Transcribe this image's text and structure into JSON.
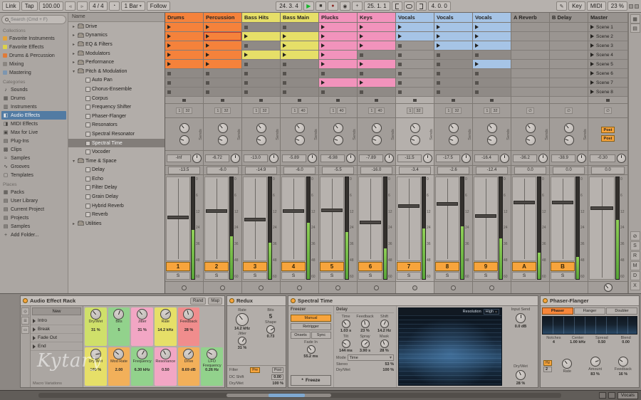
{
  "watermark": "Kytary",
  "icons": {
    "play": "▶",
    "stop": "■",
    "record": "●",
    "session_record": "◉",
    "plus": "+",
    "draw": "✎",
    "metronome": "◔",
    "nudge_down": "◃",
    "nudge_up": "▹",
    "dropdown": "▾",
    "folder_closed": "▸",
    "folder_open": "▾",
    "freeze": "*"
  },
  "transport": {
    "link": "Link",
    "tap": "Tap",
    "tempo": "100.00",
    "time_sig": "4 / 4",
    "quantize": "1 Bar",
    "follow": "Follow",
    "position": "24. 3. 4",
    "loop_start": "25. 1. 1",
    "loop_length": "4. 0. 0",
    "key": "Key",
    "midi_label": "MIDI",
    "cpu": "23 %"
  },
  "browser": {
    "search_placeholder": "Search (Cmd + F)",
    "collections_label": "Collections",
    "collections": [
      {
        "label": "Favorite Instruments",
        "color": "#e2a33c"
      },
      {
        "label": "Favorite Effects",
        "color": "#ddd24b"
      },
      {
        "label": "Drums & Percussion",
        "color": "#e07b39"
      },
      {
        "label": "Mixing",
        "color": "#8a8580"
      },
      {
        "label": "Mastering",
        "color": "#7d96b0"
      }
    ],
    "categories_label": "Categories",
    "categories": [
      {
        "label": "Sounds",
        "icon": "♪"
      },
      {
        "label": "Drums",
        "icon": "▦"
      },
      {
        "label": "Instruments",
        "icon": "▥"
      },
      {
        "label": "Audio Effects",
        "icon": "◧",
        "selected": true
      },
      {
        "label": "MIDI Effects",
        "icon": "◨"
      },
      {
        "label": "Max for Live",
        "icon": "▣"
      },
      {
        "label": "Plug-Ins",
        "icon": "▤"
      },
      {
        "label": "Clips",
        "icon": "▩"
      },
      {
        "label": "Samples",
        "icon": "≈"
      },
      {
        "label": "Grooves",
        "icon": "∿"
      },
      {
        "label": "Templates",
        "icon": "▢"
      }
    ],
    "places_label": "Places",
    "places": [
      {
        "label": "Packs",
        "icon": "▦"
      },
      {
        "label": "User Library",
        "icon": "▤"
      },
      {
        "label": "Current Project",
        "icon": "▤"
      },
      {
        "label": "Projects",
        "icon": "▤"
      },
      {
        "label": "Samples",
        "icon": "▤"
      },
      {
        "label": "Add Folder...",
        "icon": "+"
      }
    ],
    "tree_header": "Name",
    "tree": [
      {
        "label": "Drive",
        "type": "folder",
        "depth": 0
      },
      {
        "label": "Dynamics",
        "type": "folder",
        "depth": 0
      },
      {
        "label": "EQ & Filters",
        "type": "folder",
        "depth": 0
      },
      {
        "label": "Modulators",
        "type": "folder",
        "depth": 0
      },
      {
        "label": "Performance",
        "type": "folder",
        "depth": 0
      },
      {
        "label": "Pitch & Modulation",
        "type": "folder-open",
        "depth": 0
      },
      {
        "label": "Auto Pan",
        "type": "device",
        "depth": 1
      },
      {
        "label": "Chorus-Ensemble",
        "type": "device",
        "depth": 1
      },
      {
        "label": "Corpus",
        "type": "device",
        "depth": 1
      },
      {
        "label": "Frequency Shifter",
        "type": "device",
        "depth": 1
      },
      {
        "label": "Phaser-Flanger",
        "type": "device",
        "depth": 1
      },
      {
        "label": "Resonators",
        "type": "device",
        "depth": 1
      },
      {
        "label": "Spectral Resonator",
        "type": "device",
        "depth": 1
      },
      {
        "label": "Spectral Time",
        "type": "device",
        "depth": 1,
        "selected": true
      },
      {
        "label": "Vocoder",
        "type": "device",
        "depth": 1
      },
      {
        "label": "Time & Space",
        "type": "folder-open",
        "depth": 0
      },
      {
        "label": "Delay",
        "type": "device",
        "depth": 1
      },
      {
        "label": "Echo",
        "type": "device",
        "depth": 1
      },
      {
        "label": "Filter Delay",
        "type": "device",
        "depth": 1
      },
      {
        "label": "Grain Delay",
        "type": "device",
        "depth": 1
      },
      {
        "label": "Hybrid Reverb",
        "type": "device",
        "depth": 1
      },
      {
        "label": "Reverb",
        "type": "device",
        "depth": 1
      },
      {
        "label": "Utilities",
        "type": "folder",
        "depth": 0
      }
    ]
  },
  "session": {
    "sends_label": "Sends",
    "solo_label": "S",
    "meter_scale": [
      "0",
      "6",
      "12",
      "24",
      "36",
      "48",
      "60"
    ],
    "tracks": [
      {
        "name": "Drums",
        "color": "#f5823b",
        "clips": [
          1,
          1,
          1,
          1,
          1,
          0,
          0,
          0
        ],
        "io": [
          "1",
          "32"
        ],
        "peak": "-Inf",
        "vol": "-13.5",
        "btn": "1",
        "fader": 0.52,
        "meter": 0.48
      },
      {
        "name": "Percussion",
        "color": "#f5823b",
        "clips": [
          1,
          2,
          1,
          1,
          1,
          0,
          0,
          0
        ],
        "io": [
          "1",
          "32"
        ],
        "peak": "-6.72",
        "vol": "-6.0",
        "btn": "2",
        "fader": 0.6,
        "meter": 0.42
      },
      {
        "name": "Bass Hits",
        "color": "#e6df68",
        "clips": [
          0,
          1,
          0,
          1,
          0,
          0,
          0,
          0
        ],
        "io": [
          "1",
          "32"
        ],
        "peak": "-13.0",
        "vol": "-14.9",
        "btn": "3",
        "fader": 0.5,
        "meter": 0.36
      },
      {
        "name": "Bass Main",
        "color": "#e6df68",
        "clips": [
          0,
          1,
          1,
          1,
          0,
          0,
          0,
          0
        ],
        "io": [
          "1",
          "40"
        ],
        "peak": "-5.89",
        "vol": "-6.0",
        "btn": "4",
        "fader": 0.6,
        "meter": 0.55
      },
      {
        "name": "Plucks",
        "color": "#f293bc",
        "clips": [
          1,
          1,
          1,
          1,
          1,
          0,
          1,
          0
        ],
        "io": [
          "1",
          "40"
        ],
        "peak": "-6.98",
        "vol": "-5.5",
        "btn": "5",
        "fader": 0.61,
        "meter": 0.46
      },
      {
        "name": "Keys",
        "color": "#f293bc",
        "clips": [
          1,
          1,
          1,
          0,
          1,
          0,
          1,
          0
        ],
        "io": [
          "1",
          "40"
        ],
        "peak": "-7.89",
        "vol": "-16.0",
        "btn": "6",
        "fader": 0.46,
        "meter": 0.3
      },
      {
        "name": "Vocals",
        "color": "#a6c4e6",
        "clips": [
          1,
          1,
          0,
          0,
          0,
          0,
          0,
          0
        ],
        "io": [
          "1",
          "32"
        ],
        "peak": "-11.5",
        "vol": "-3.4",
        "btn": "7",
        "fader": 0.66,
        "meter": 0.5,
        "selected": true
      },
      {
        "name": "Vocals",
        "color": "#a6c4e6",
        "clips": [
          1,
          1,
          1,
          0,
          0,
          0,
          0,
          0
        ],
        "io": [
          "1",
          "32"
        ],
        "peak": "-17.5",
        "vol": "-2.6",
        "btn": "8",
        "fader": 0.68,
        "meter": 0.52
      },
      {
        "name": "Vocals",
        "color": "#a6c4e6",
        "clips": [
          1,
          1,
          1,
          0,
          1,
          0,
          0,
          0
        ],
        "io": [
          "1",
          "32"
        ],
        "peak": "-16.4",
        "vol": "-12.4",
        "btn": "9",
        "fader": 0.54,
        "meter": 0.4
      },
      {
        "name": "A Reverb",
        "color": "#98938f",
        "type": "return",
        "clips": [],
        "io": [
          "∅"
        ],
        "peak": "-36.2",
        "vol": "0.0",
        "btn": "A",
        "fader": 0.7,
        "meter": 0.26
      },
      {
        "name": "B Delay",
        "color": "#98938f",
        "type": "return",
        "clips": [],
        "io": [
          "∅"
        ],
        "peak": "-38.9",
        "vol": "0.0",
        "btn": "B",
        "fader": 0.7,
        "meter": 0.22
      }
    ],
    "master": {
      "name": "Master",
      "scenes": [
        "Scene 1",
        "Scene 2",
        "Scene 3",
        "Scene 4",
        "Scene 5",
        "Scene 6",
        "Scene 7",
        "Scene 8"
      ],
      "sends": [
        "Post",
        "Post"
      ],
      "peak": "-0.30",
      "vol": "0.0",
      "fader": 0.7,
      "meter": 0.58
    }
  },
  "right_strip": {
    "top": [
      {
        "glyph": "▦",
        "name": "grid-view-toggle"
      },
      {
        "glyph": "▤",
        "name": "list-view-toggle"
      }
    ],
    "bottom": [
      {
        "glyph": "⊘",
        "name": "io-section-toggle"
      },
      {
        "glyph": "S",
        "name": "sends-section-toggle"
      },
      {
        "glyph": "R",
        "name": "returns-section-toggle"
      },
      {
        "glyph": "M",
        "name": "mixer-section-toggle"
      },
      {
        "glyph": "D",
        "name": "track-delay-section-toggle"
      },
      {
        "glyph": "X",
        "name": "crossfader-section-toggle"
      }
    ]
  },
  "devices": {
    "rack": {
      "title": "Audio Effect Rack",
      "rand": "Rand",
      "map": "Map",
      "new_button": "New",
      "variations_label": "Macro Variations",
      "variations": [
        "Intro",
        "Break",
        "Fade Out",
        "End"
      ],
      "macros": [
        {
          "name": "Dry/Wet",
          "value": "31 %",
          "color": "#cfe06a"
        },
        {
          "name": "Bits",
          "value": "5",
          "color": "#92d28c"
        },
        {
          "name": "Jitter",
          "value": "31 %",
          "color": "#f2a6c4"
        },
        {
          "name": "Rate",
          "value": "14.2 kHz",
          "color": "#e6df68"
        },
        {
          "name": "Feedback",
          "value": "28 %",
          "color": "#f08d8d"
        },
        {
          "name": "Dry/Wet",
          "value": "100 %",
          "color": "#e6df68"
        },
        {
          "name": "Mod Rate",
          "value": "2.00",
          "color": "#f2b05a"
        },
        {
          "name": "Frequency",
          "value": "6.30 kHz",
          "color": "#92d28c"
        },
        {
          "name": "Resonance",
          "value": "0.50",
          "color": "#f2a6c4"
        },
        {
          "name": "Drive",
          "value": "8.69 dB",
          "color": "#f2b05a"
        },
        {
          "name": "LFO Frequency",
          "value": "0.26 Hz",
          "color": "#92d28c"
        }
      ]
    },
    "redux": {
      "title": "Redux",
      "rate_label": "Rate",
      "rate": "14.2 kHz",
      "jitter_label": "Jitter",
      "jitter": "31 %",
      "bits_label": "Bits",
      "bits": "5",
      "shape_label": "Shape",
      "shape": "0.73",
      "filter_label": "Filter",
      "pre": "Pre",
      "post": "Post",
      "dc_shift_label": "DC Shift",
      "dc_shift": "0.00",
      "dry_wet_label": "Dry/Wet",
      "dry_wet": "100 %"
    },
    "spectral": {
      "title": "Spectral Time",
      "freezer_label": "Freezer",
      "manual": "Manual",
      "retrigger": "Retrigger",
      "onsets": "Onsets",
      "sync": "Sync",
      "fade_in_label": "Fade In",
      "fade_in": "55.2 ms",
      "freeze": "Freeze",
      "delay_label": "Delay",
      "time_label": "Time",
      "time": "1.03 s",
      "feedback_label": "Feedback",
      "feedback": "23 %",
      "shift_label": "Shift",
      "shift": "14.2 Hz",
      "tilt_label": "Tilt",
      "tilt": "144 ms",
      "spray_label": "Spray",
      "spray": "3.90 s",
      "mask_label": "Mask",
      "mask": "28 %",
      "mode_label": "Mode",
      "mode": "Time",
      "stereo_label": "Stereo",
      "stereo": "53 %",
      "drywet_label": "Dry/Wet",
      "drywet": "100 %",
      "resolution_label": "Resolution",
      "resolution": "High",
      "input_send_label": "Input Send",
      "input_send": "0.0 dB",
      "out_drywet_label": "Dry/Wet",
      "out_drywet": "28 %"
    },
    "phaser": {
      "title": "Phaser-Flanger",
      "tabs": [
        "Phaser",
        "Flanger",
        "Doubler"
      ],
      "params": [
        {
          "label": "Notches",
          "value": "4"
        },
        {
          "label": "Center",
          "value": "1.00 kHz"
        },
        {
          "label": "Spread",
          "value": "0.50"
        },
        {
          "label": "Blend",
          "value": "0.00"
        }
      ],
      "hz": "Hz",
      "rate": "2",
      "rate_label": "Rate",
      "amount_label": "Amount",
      "amount": "83 %",
      "feedback_label": "Feedback",
      "feedback": "16 %"
    }
  },
  "status": {
    "selected_track": "Vocals"
  }
}
